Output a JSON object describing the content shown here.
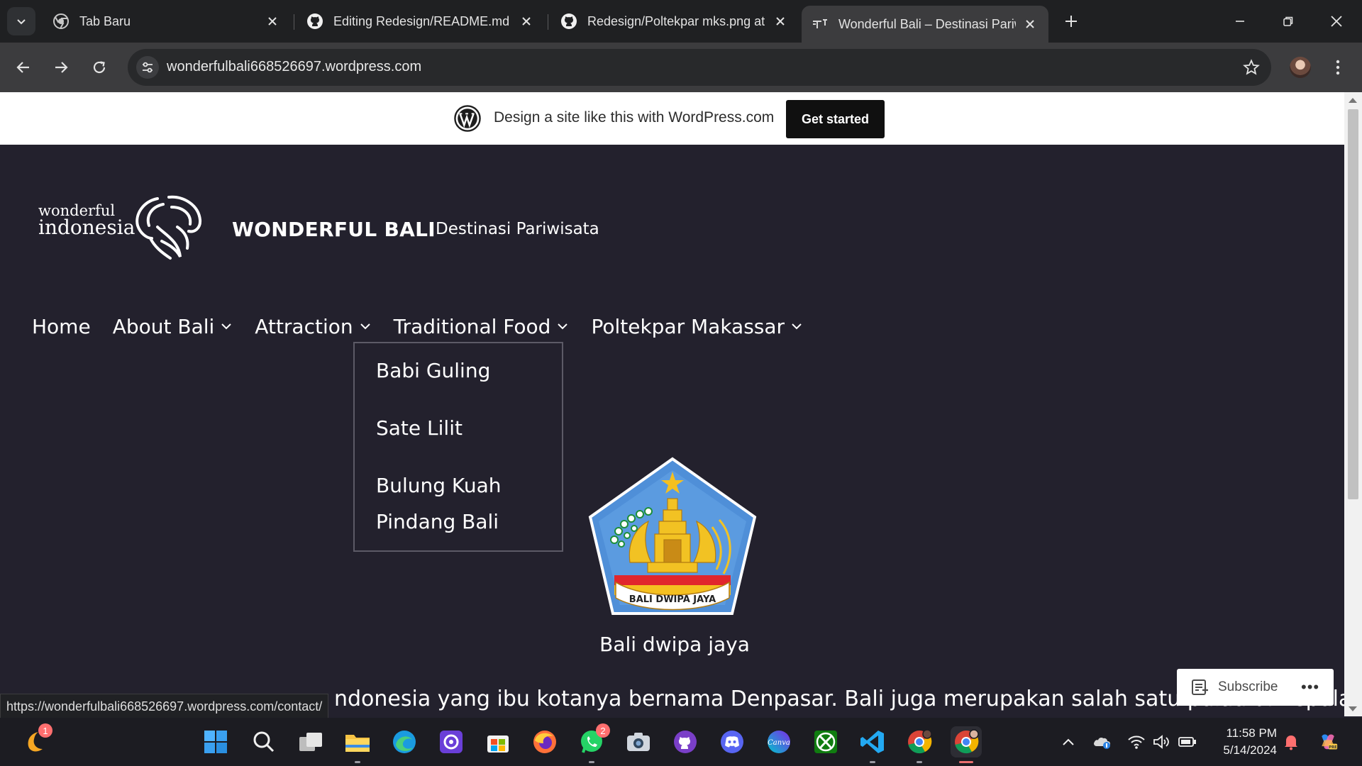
{
  "tabs": [
    {
      "title": "Tab Baru",
      "icon": "chrome-icon"
    },
    {
      "title": "Editing Redesign/README.md at",
      "icon": "github-icon"
    },
    {
      "title": "Redesign/Poltekpar mks.png at",
      "icon": "github-icon"
    },
    {
      "title": "Wonderful Bali – Destinasi Pariwisata",
      "icon": "wordpress-tab-icon",
      "active": true
    }
  ],
  "address_bar": {
    "url": "wonderfulbali668526697.wordpress.com"
  },
  "wp_banner": {
    "text": "Design a site like this with WordPress.com",
    "button": "Get started"
  },
  "site": {
    "logo_text_top": "wonderful",
    "logo_text_bottom": "indonesia",
    "title": "WONDERFUL BALI",
    "tagline": "Destinasi Pariwisata"
  },
  "menu": {
    "items": [
      {
        "label": "Home",
        "has_submenu": false
      },
      {
        "label": "About Bali",
        "has_submenu": true
      },
      {
        "label": "Attraction",
        "has_submenu": true
      },
      {
        "label": "Traditional Food",
        "has_submenu": true
      },
      {
        "label": "Poltekpar Makassar",
        "has_submenu": true
      }
    ],
    "submenu_items": [
      "Babi Guling",
      "Sate Lilit",
      "Bulung Kuah",
      "Pindang Bali"
    ]
  },
  "crest": {
    "motto": "BALI DWIPA JAYA"
  },
  "caption": "Bali dwipa jaya",
  "body_text": "ndonesia yang ibu kotanya bernama Denpasar. Bali juga merupakan salah satu pulau di Kepulauan",
  "status_url": "https://wonderfulbali668526697.wordpress.com/contact/",
  "subscribe": {
    "label": "Subscribe",
    "more": "•••"
  },
  "taskbar": {
    "badges": {
      "start_left": "1",
      "whatsapp": "2"
    },
    "time": "11:58 PM",
    "date": "5/14/2024"
  },
  "colors": {
    "page_bg": "#23212d",
    "wp_banner_bg": "#ffffff",
    "button_bg": "#101010"
  }
}
